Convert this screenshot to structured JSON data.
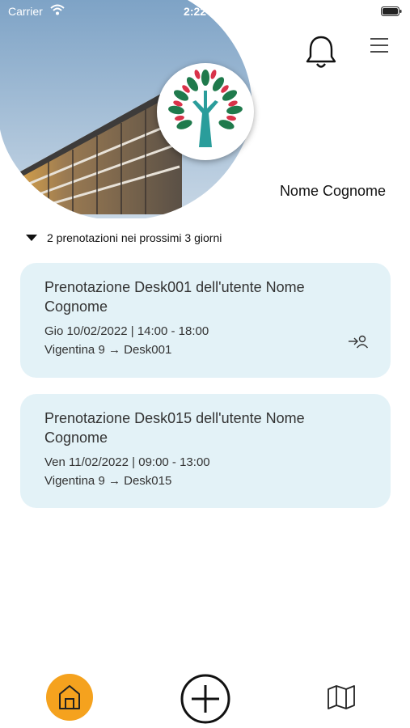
{
  "status_bar": {
    "carrier": "Carrier",
    "time": "2:22 PM"
  },
  "header": {
    "user_name": "Nome Cognome",
    "icons": [
      "bell-icon",
      "hamburger-menu-icon",
      "company-tree-logo"
    ]
  },
  "upcoming": {
    "label": "2 prenotazioni nei prossimi 3 giorni"
  },
  "bookings": [
    {
      "title": "Prenotazione Desk001 dell'utente Nome Cognome",
      "date": "Gio 10/02/2022 | 14:00 - 18:00",
      "route": "Vigentina 9 → Desk001",
      "has_checkin": true
    },
    {
      "title": "Prenotazione Desk015 dell'utente Nome Cognome",
      "date": "Ven 11/02/2022 | 09:00 - 13:00",
      "route": "Vigentina 9 → Desk015",
      "has_checkin": false
    }
  ],
  "bottom_nav": {
    "items": [
      "home-icon",
      "add-circle-icon",
      "map-icon"
    ],
    "active": "home-icon"
  },
  "colors": {
    "accent": "#f5a21e",
    "card_background": "#e3f2f7",
    "logo_trunk": "#2a9d9b",
    "logo_leaf_green": "#1f7a4c",
    "logo_leaf_red": "#d9334a"
  }
}
